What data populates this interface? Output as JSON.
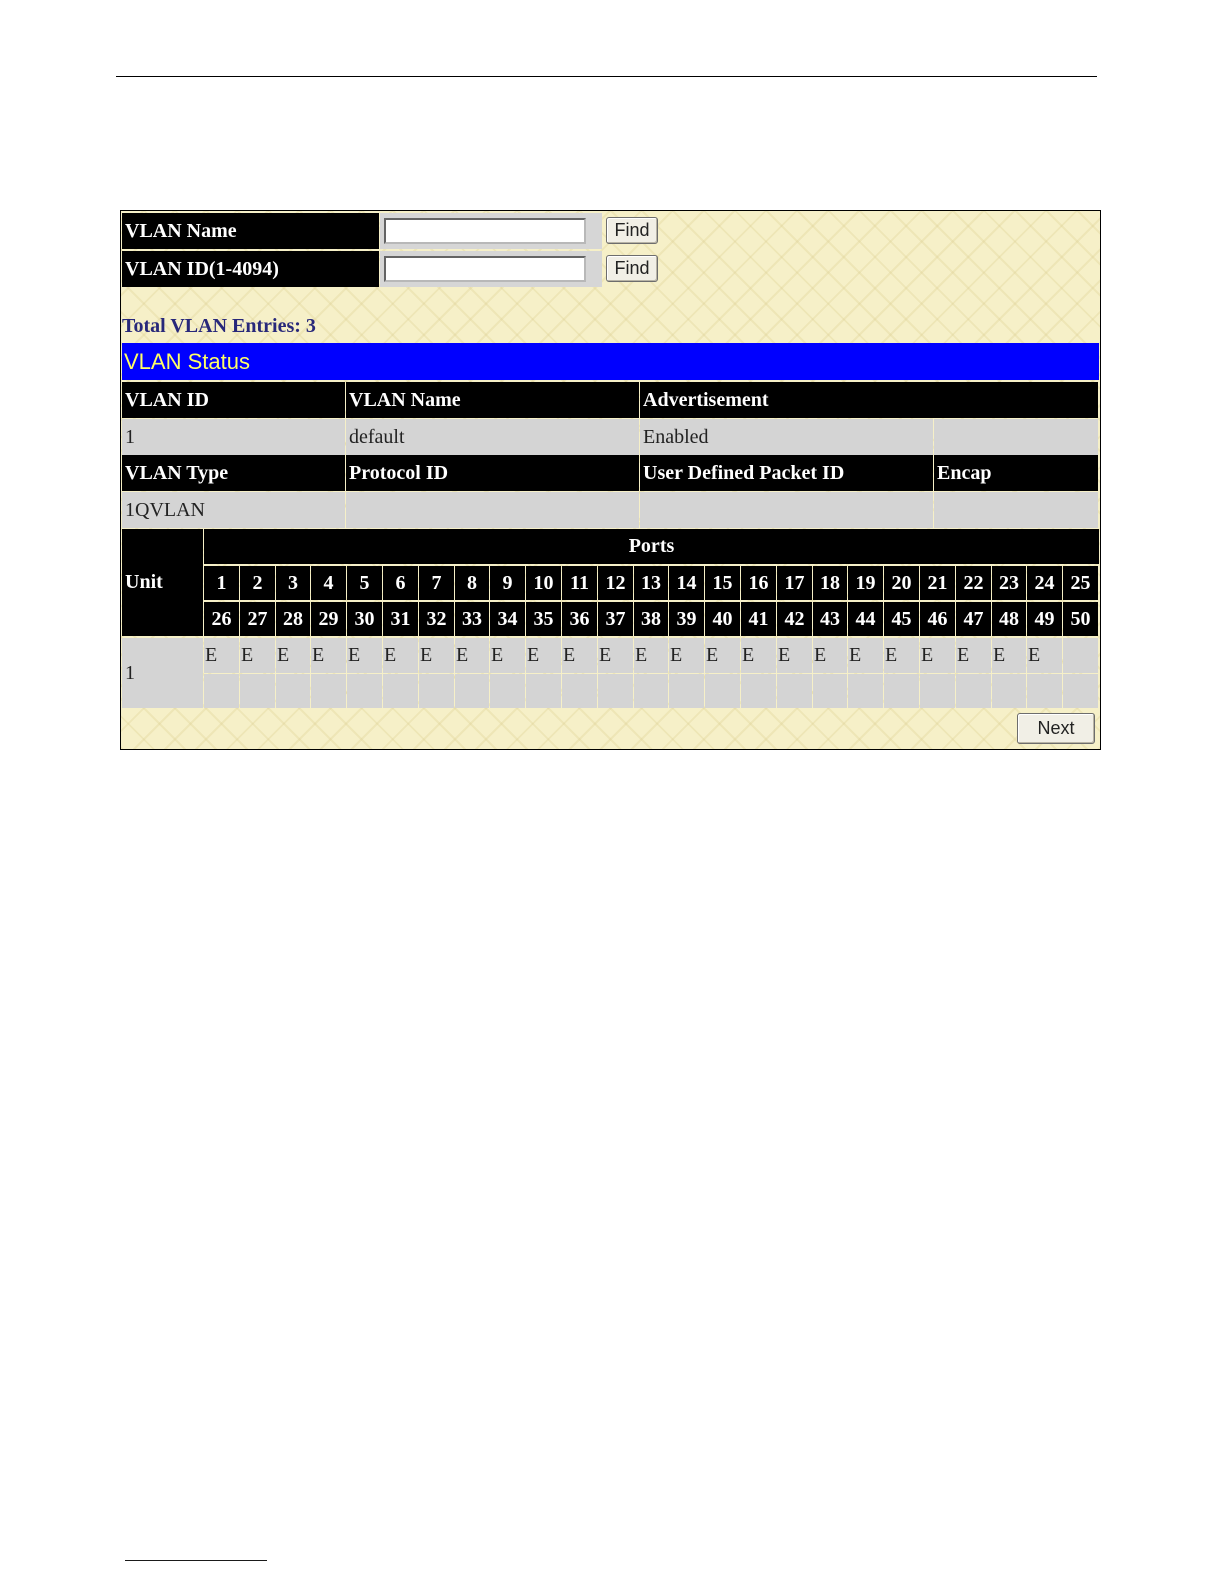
{
  "search": {
    "name_label": "VLAN Name",
    "id_label": "VLAN ID(1-4094)",
    "name_value": "",
    "id_value": "",
    "find_label": "Find"
  },
  "total_entries": "Total VLAN Entries: 3",
  "status_title": "VLAN Status",
  "table": {
    "headers_row1": [
      "VLAN ID",
      "VLAN Name",
      "Advertisement"
    ],
    "values_row1": [
      "1",
      "default",
      "Enabled",
      ""
    ],
    "headers_row2": [
      "VLAN Type",
      "Protocol ID",
      "User Defined Packet ID",
      "Encap"
    ],
    "values_row2": [
      "1QVLAN",
      "",
      "",
      ""
    ]
  },
  "ports": {
    "unit_label": "Unit",
    "ports_label": "Ports",
    "row1": [
      "1",
      "2",
      "3",
      "4",
      "5",
      "6",
      "7",
      "8",
      "9",
      "10",
      "11",
      "12",
      "13",
      "14",
      "15",
      "16",
      "17",
      "18",
      "19",
      "20",
      "21",
      "22",
      "23",
      "24",
      "25"
    ],
    "row2": [
      "26",
      "27",
      "28",
      "29",
      "30",
      "31",
      "32",
      "33",
      "34",
      "35",
      "36",
      "37",
      "38",
      "39",
      "40",
      "41",
      "42",
      "43",
      "44",
      "45",
      "46",
      "47",
      "48",
      "49",
      "50"
    ],
    "unit_value": "1",
    "status_row1": [
      "E",
      "E",
      "E",
      "E",
      "E",
      "E",
      "E",
      "E",
      "E",
      "E",
      "E",
      "E",
      "E",
      "E",
      "E",
      "E",
      "E",
      "E",
      "E",
      "E",
      "E",
      "E",
      "E",
      "E",
      ""
    ],
    "status_row2": [
      "",
      "",
      "",
      "",
      "",
      "",
      "",
      "",
      "",
      "",
      "",
      "",
      "",
      "",
      "",
      "",
      "",
      "",
      "",
      "",
      "",
      "",
      "",
      "",
      ""
    ]
  },
  "next_label": "Next"
}
